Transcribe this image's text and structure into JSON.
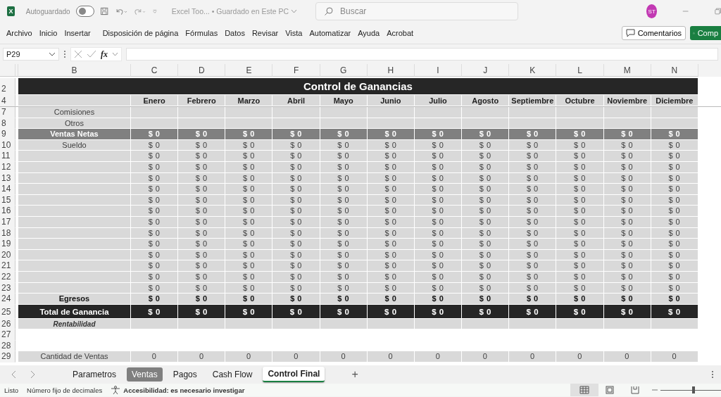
{
  "titlebar": {
    "app_icon_letter": "X",
    "autosave_label": "Autoguardado",
    "autosave_on": false,
    "document": "Excel Too... • Guardado en Este PC",
    "search": {
      "placeholder": "Buscar"
    },
    "avatar": "ST"
  },
  "menu": [
    "Archivo",
    "Inicio",
    "Insertar",
    "Disposición de página",
    "Fórmulas",
    "Datos",
    "Revisar",
    "Vista",
    "Automatizar",
    "Ayuda",
    "Acrobat"
  ],
  "actions": {
    "comments": "Comentarios",
    "share": "Comp"
  },
  "formula_bar": {
    "name_box": "P29",
    "fx": "fx"
  },
  "sheet": {
    "columns": [
      "B",
      "C",
      "D",
      "E",
      "F",
      "G",
      "H",
      "I",
      "J",
      "K",
      "L",
      "M",
      "N"
    ],
    "rows": [
      {
        "row": "2",
        "kind": "title",
        "title": "Control de Ganancias"
      },
      {
        "row": "4",
        "kind": "months",
        "cells": [
          "Enero",
          "Febrero",
          "Marzo",
          "Abril",
          "Mayo",
          "Junio",
          "Julio",
          "Agosto",
          "Septiembre",
          "Octubre",
          "Noviembre",
          "Diciembre"
        ]
      },
      {
        "row": "7",
        "kind": "plain",
        "label": "Comisiones"
      },
      {
        "row": "8",
        "kind": "plain",
        "label": "Otros"
      },
      {
        "row": "9",
        "kind": "net",
        "label": "Ventas Netas",
        "cells": [
          "$ 0",
          "$ 0",
          "$ 0",
          "$ 0",
          "$ 0",
          "$ 0",
          "$ 0",
          "$ 0",
          "$ 0",
          "$ 0",
          "$ 0",
          "$ 0"
        ]
      },
      {
        "row": "10",
        "kind": "plain",
        "label": "Sueldo",
        "cells": [
          "$ 0",
          "$ 0",
          "$ 0",
          "$ 0",
          "$ 0",
          "$ 0",
          "$ 0",
          "$ 0",
          "$ 0",
          "$ 0",
          "$ 0",
          "$ 0"
        ]
      },
      {
        "row": "11",
        "kind": "plain",
        "cells": [
          "$ 0",
          "$ 0",
          "$ 0",
          "$ 0",
          "$ 0",
          "$ 0",
          "$ 0",
          "$ 0",
          "$ 0",
          "$ 0",
          "$ 0",
          "$ 0"
        ]
      },
      {
        "row": "12",
        "kind": "plain",
        "cells": [
          "$ 0",
          "$ 0",
          "$ 0",
          "$ 0",
          "$ 0",
          "$ 0",
          "$ 0",
          "$ 0",
          "$ 0",
          "$ 0",
          "$ 0",
          "$ 0"
        ]
      },
      {
        "row": "13",
        "kind": "plain",
        "cells": [
          "$ 0",
          "$ 0",
          "$ 0",
          "$ 0",
          "$ 0",
          "$ 0",
          "$ 0",
          "$ 0",
          "$ 0",
          "$ 0",
          "$ 0",
          "$ 0"
        ]
      },
      {
        "row": "14",
        "kind": "plain",
        "cells": [
          "$ 0",
          "$ 0",
          "$ 0",
          "$ 0",
          "$ 0",
          "$ 0",
          "$ 0",
          "$ 0",
          "$ 0",
          "$ 0",
          "$ 0",
          "$ 0"
        ]
      },
      {
        "row": "15",
        "kind": "plain",
        "cells": [
          "$ 0",
          "$ 0",
          "$ 0",
          "$ 0",
          "$ 0",
          "$ 0",
          "$ 0",
          "$ 0",
          "$ 0",
          "$ 0",
          "$ 0",
          "$ 0"
        ]
      },
      {
        "row": "16",
        "kind": "plain",
        "cells": [
          "$ 0",
          "$ 0",
          "$ 0",
          "$ 0",
          "$ 0",
          "$ 0",
          "$ 0",
          "$ 0",
          "$ 0",
          "$ 0",
          "$ 0",
          "$ 0"
        ]
      },
      {
        "row": "17",
        "kind": "plain",
        "cells": [
          "$ 0",
          "$ 0",
          "$ 0",
          "$ 0",
          "$ 0",
          "$ 0",
          "$ 0",
          "$ 0",
          "$ 0",
          "$ 0",
          "$ 0",
          "$ 0"
        ]
      },
      {
        "row": "18",
        "kind": "plain",
        "cells": [
          "$ 0",
          "$ 0",
          "$ 0",
          "$ 0",
          "$ 0",
          "$ 0",
          "$ 0",
          "$ 0",
          "$ 0",
          "$ 0",
          "$ 0",
          "$ 0"
        ]
      },
      {
        "row": "19",
        "kind": "plain",
        "cells": [
          "$ 0",
          "$ 0",
          "$ 0",
          "$ 0",
          "$ 0",
          "$ 0",
          "$ 0",
          "$ 0",
          "$ 0",
          "$ 0",
          "$ 0",
          "$ 0"
        ]
      },
      {
        "row": "20",
        "kind": "plain",
        "cells": [
          "$ 0",
          "$ 0",
          "$ 0",
          "$ 0",
          "$ 0",
          "$ 0",
          "$ 0",
          "$ 0",
          "$ 0",
          "$ 0",
          "$ 0",
          "$ 0"
        ]
      },
      {
        "row": "21",
        "kind": "plain",
        "cells": [
          "$ 0",
          "$ 0",
          "$ 0",
          "$ 0",
          "$ 0",
          "$ 0",
          "$ 0",
          "$ 0",
          "$ 0",
          "$ 0",
          "$ 0",
          "$ 0"
        ]
      },
      {
        "row": "22",
        "kind": "plain",
        "cells": [
          "$ 0",
          "$ 0",
          "$ 0",
          "$ 0",
          "$ 0",
          "$ 0",
          "$ 0",
          "$ 0",
          "$ 0",
          "$ 0",
          "$ 0",
          "$ 0"
        ]
      },
      {
        "row": "23",
        "kind": "plain",
        "cells": [
          "$ 0",
          "$ 0",
          "$ 0",
          "$ 0",
          "$ 0",
          "$ 0",
          "$ 0",
          "$ 0",
          "$ 0",
          "$ 0",
          "$ 0",
          "$ 0"
        ]
      },
      {
        "row": "24",
        "kind": "strong",
        "label": "Egresos",
        "cells": [
          "$ 0",
          "$ 0",
          "$ 0",
          "$ 0",
          "$ 0",
          "$ 0",
          "$ 0",
          "$ 0",
          "$ 0",
          "$ 0",
          "$ 0",
          "$ 0"
        ]
      },
      {
        "row": "25",
        "kind": "total",
        "label": "Total de Ganancia",
        "cells": [
          "$ 0",
          "$ 0",
          "$ 0",
          "$ 0",
          "$ 0",
          "$ 0",
          "$ 0",
          "$ 0",
          "$ 0",
          "$ 0",
          "$ 0",
          "$ 0"
        ]
      },
      {
        "row": "26",
        "kind": "note",
        "label": "Rentabilidad"
      },
      {
        "row": "27",
        "kind": "blank"
      },
      {
        "row": "28",
        "kind": "blank"
      },
      {
        "row": "29",
        "kind": "plain",
        "label": "Cantidad de Ventas",
        "cells": [
          "0",
          "0",
          "0",
          "0",
          "0",
          "0",
          "0",
          "0",
          "0",
          "0",
          "0",
          "0"
        ]
      }
    ]
  },
  "tabs": [
    {
      "label": "Parametros",
      "selected": false
    },
    {
      "label": "Ventas",
      "selected": false,
      "color": "#7f7f7f"
    },
    {
      "label": "Pagos",
      "selected": false
    },
    {
      "label": "Cash Flow",
      "selected": false
    },
    {
      "label": "Control Final",
      "selected": true
    }
  ],
  "add_sheet": "+",
  "status": {
    "ready": "Listo",
    "mode": "Número fijo de decimales",
    "accessibility": "Accesibilidad: es necesario investigar",
    "zoom": {
      "level": 0.55
    }
  }
}
